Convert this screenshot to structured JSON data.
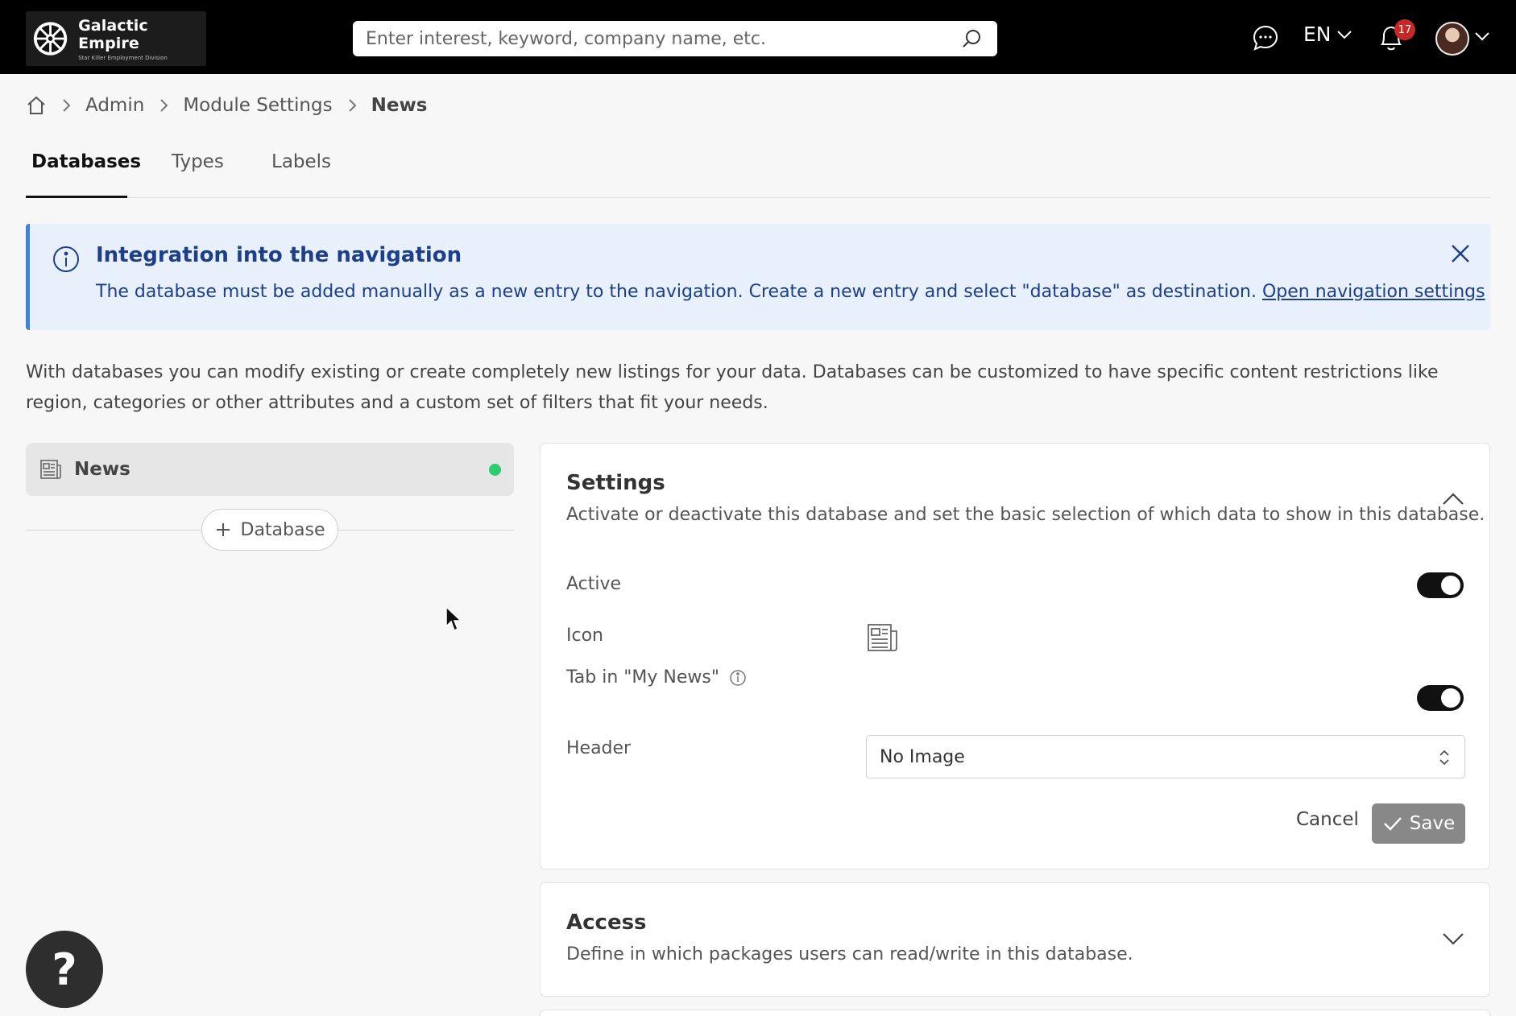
{
  "brand": {
    "title": "Galactic Empire",
    "subtitle": "Star Killer Employment Division"
  },
  "header": {
    "search_placeholder": "Enter interest, keyword, company name, etc.",
    "language": "EN",
    "notifications_count": "17"
  },
  "breadcrumb": {
    "items": [
      "Admin",
      "Module Settings",
      "News"
    ]
  },
  "tabs": [
    {
      "label": "Databases",
      "active": true
    },
    {
      "label": "Types",
      "active": false
    },
    {
      "label": "Labels",
      "active": false
    }
  ],
  "banner": {
    "title": "Integration into the navigation",
    "body": "The database must be added manually as a new entry to the navigation. Create a new entry and select \"database\" as destination.",
    "link": "Open navigation settings"
  },
  "description": "With databases you can modify existing or create completely new listings for your data. Databases can be customized to have specific content restrictions like region, categories or other attributes and a custom set of filters that fit your needs.",
  "database_list": {
    "items": [
      {
        "label": "News",
        "status": "active",
        "status_color": "#2ecc71"
      }
    ],
    "add_label": "Database"
  },
  "settings": {
    "title": "Settings",
    "subtitle": "Activate or deactivate this database and set the basic selection of which data to show in this database.",
    "active_label": "Active",
    "active_on": true,
    "icon_label": "Icon",
    "icon_name": "newspaper-icon",
    "tab_label": "Tab in \"My News\"",
    "tab_on": true,
    "header_label": "Header",
    "header_value": "No Image",
    "cancel_label": "Cancel",
    "save_label": "Save"
  },
  "access": {
    "title": "Access",
    "subtitle": "Define in which packages users can read/write in this database."
  },
  "help": {
    "label": "?"
  }
}
